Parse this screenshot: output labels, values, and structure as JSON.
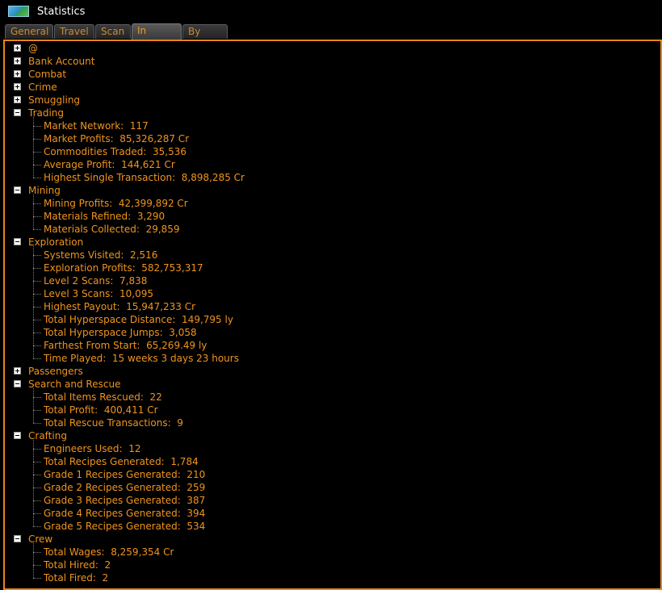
{
  "window": {
    "title": "Statistics",
    "icon": "landscape-icon"
  },
  "tabs": [
    {
      "label": "General",
      "active": false
    },
    {
      "label": "Travel",
      "active": false
    },
    {
      "label": "Scan",
      "active": false
    },
    {
      "label": "In Game",
      "active": true
    },
    {
      "label": "By Ship",
      "active": false
    }
  ],
  "tree": [
    {
      "label": "@",
      "expanded": false,
      "children": []
    },
    {
      "label": "Bank Account",
      "expanded": false,
      "children": []
    },
    {
      "label": "Combat",
      "expanded": false,
      "children": []
    },
    {
      "label": "Crime",
      "expanded": false,
      "children": []
    },
    {
      "label": "Smuggling",
      "expanded": false,
      "children": []
    },
    {
      "label": "Trading",
      "expanded": true,
      "children": [
        "Market Network:  117",
        "Market Profits:  85,326,287 Cr",
        "Commodities Traded:  35,536",
        "Average Profit:  144,621 Cr",
        "Highest Single Transaction:  8,898,285 Cr"
      ]
    },
    {
      "label": "Mining",
      "expanded": true,
      "children": [
        "Mining Profits:  42,399,892 Cr",
        "Materials Refined:  3,290",
        "Materials Collected:  29,859"
      ]
    },
    {
      "label": "Exploration",
      "expanded": true,
      "children": [
        "Systems Visited:  2,516",
        "Exploration Profits:  582,753,317",
        "Level 2 Scans:  7,838",
        "Level 3 Scans:  10,095",
        "Highest Payout:  15,947,233 Cr",
        "Total Hyperspace Distance:  149,795 ly",
        "Total Hyperspace Jumps:  3,058",
        "Farthest From Start:  65,269.49 ly",
        "Time Played:  15 weeks 3 days 23 hours"
      ]
    },
    {
      "label": "Passengers",
      "expanded": false,
      "children": []
    },
    {
      "label": "Search and Rescue",
      "expanded": true,
      "children": [
        "Total Items Rescued:  22",
        "Total Profit:  400,411 Cr",
        "Total Rescue Transactions:  9"
      ]
    },
    {
      "label": "Crafting",
      "expanded": true,
      "children": [
        "Engineers Used:  12",
        "Total Recipes Generated:  1,784",
        "Grade 1 Recipes Generated:  210",
        "Grade 2 Recipes Generated:  259",
        "Grade 3 Recipes Generated:  387",
        "Grade 4 Recipes Generated:  394",
        "Grade 5 Recipes Generated:  534"
      ]
    },
    {
      "label": "Crew",
      "expanded": true,
      "children": [
        "Total Wages:  8,259,354 Cr",
        "Total Hired:  2",
        "Total Fired:  2"
      ]
    }
  ]
}
